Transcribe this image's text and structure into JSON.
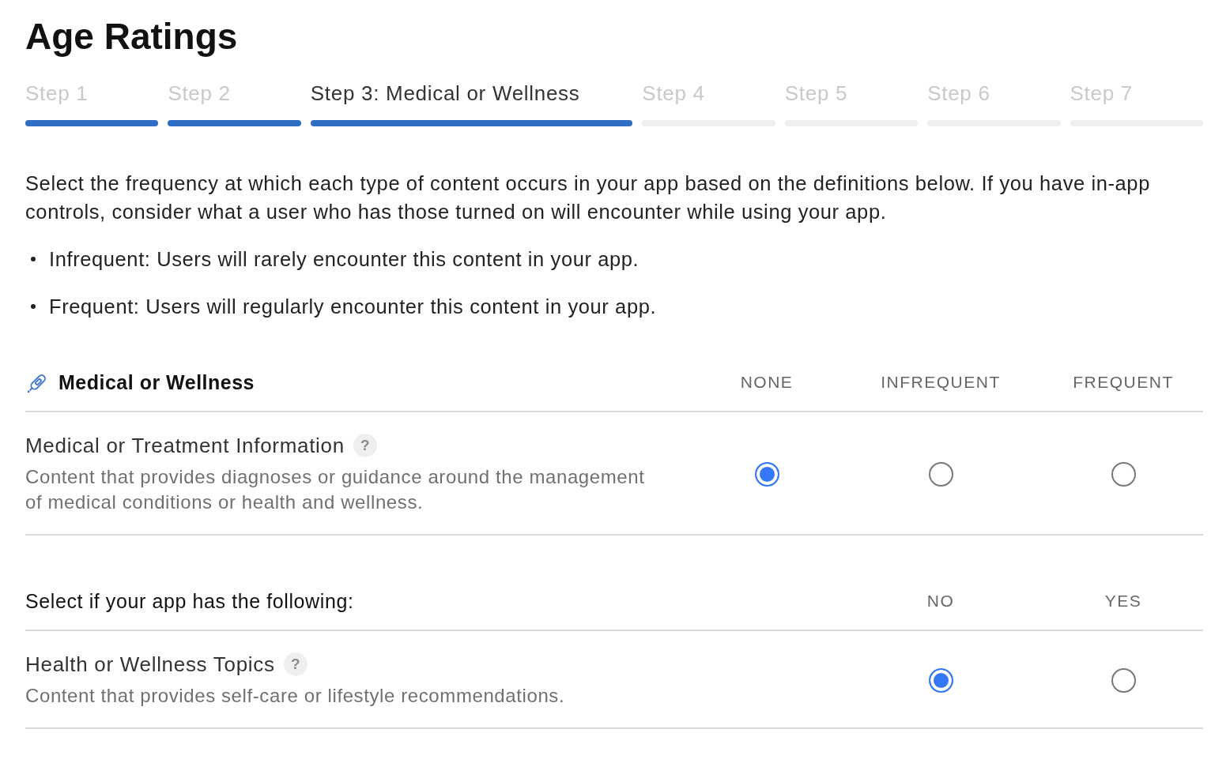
{
  "page_title": "Age Ratings",
  "steps": [
    {
      "label": "Step 1",
      "completed": true,
      "selected": false
    },
    {
      "label": "Step 2",
      "completed": true,
      "selected": false
    },
    {
      "label": "Step 3: Medical or Wellness",
      "completed": false,
      "selected": true
    },
    {
      "label": "Step 4",
      "completed": false,
      "selected": false
    },
    {
      "label": "Step 5",
      "completed": false,
      "selected": false
    },
    {
      "label": "Step 6",
      "completed": false,
      "selected": false
    },
    {
      "label": "Step 7",
      "completed": false,
      "selected": false
    }
  ],
  "instructions": {
    "text": "Select the frequency at which each type of content occurs in your app based on the definitions below. If you have in-app controls, consider what a user who has those turned on will encounter while using your app.",
    "bullets": [
      "Infrequent: Users will rarely encounter this content in your app.",
      "Frequent: Users will regularly encounter this content in your app."
    ]
  },
  "frequency_table": {
    "title": "Medical or Wellness",
    "columns": [
      "NONE",
      "INFREQUENT",
      "FREQUENT"
    ],
    "rows": [
      {
        "title": "Medical or Treatment Information",
        "help": "?",
        "description": "Content that provides diagnoses or guidance around the management of medical conditions or health and wellness.",
        "options": [
          {
            "selected": true
          },
          {
            "selected": false
          },
          {
            "selected": false
          }
        ]
      }
    ]
  },
  "yes_no_table": {
    "title": "Select if your app has the following:",
    "columns": [
      "NO",
      "YES"
    ],
    "rows": [
      {
        "title": "Health or Wellness Topics",
        "help": "?",
        "description": "Content that provides self-care or lifestyle recommendations.",
        "options": [
          {
            "selected": true
          },
          {
            "selected": false
          }
        ]
      }
    ]
  }
}
